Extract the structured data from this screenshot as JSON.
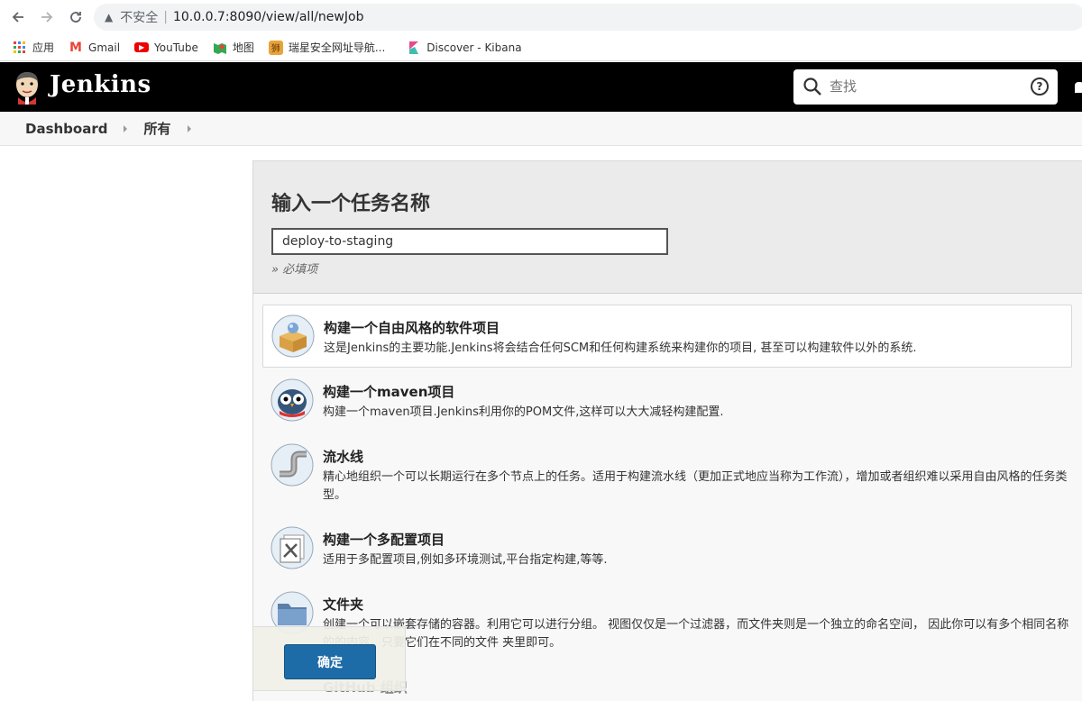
{
  "browser": {
    "insecure_label": "不安全",
    "separator": "|",
    "url": "10.0.0.7:8090/view/all/newJob",
    "bookmarks": [
      {
        "label": "应用",
        "icon": "apps-grid-icon"
      },
      {
        "label": "Gmail",
        "icon": "gmail-icon"
      },
      {
        "label": "YouTube",
        "icon": "youtube-icon"
      },
      {
        "label": "地图",
        "icon": "maps-icon"
      },
      {
        "label": "瑞星安全网址导航...",
        "icon": "rising-icon"
      },
      {
        "label": "Discover - Kibana",
        "icon": "kibana-icon"
      }
    ]
  },
  "header": {
    "brand": "Jenkins",
    "search_placeholder": "查找",
    "help_glyph": "?"
  },
  "breadcrumb": {
    "items": [
      "Dashboard",
      "所有"
    ]
  },
  "form": {
    "title": "输入一个任务名称",
    "job_name_value": "deploy-to-staging",
    "required_note": "» 必填项"
  },
  "job_types": [
    {
      "title": "构建一个自由风格的软件项目",
      "desc": "这是Jenkins的主要功能.Jenkins将会结合任何SCM和任何构建系统来构建你的项目, 甚至可以构建软件以外的系统.",
      "selected": true
    },
    {
      "title": "构建一个maven项目",
      "desc": "构建一个maven项目.Jenkins利用你的POM文件,这样可以大大减轻构建配置."
    },
    {
      "title": "流水线",
      "desc": "精心地组织一个可以长期运行在多个节点上的任务。适用于构建流水线（更加正式地应当称为工作流），增加或者组织难以采用自由风格的任务类型。"
    },
    {
      "title": "构建一个多配置项目",
      "desc": "适用于多配置项目,例如多环境测试,平台指定构建,等等."
    },
    {
      "title": "文件夹",
      "desc": "创建一个可以嵌套存储的容器。利用它可以进行分组。 视图仅仅是一个过滤器，而文件夹则是一个独立的命名空间， 因此你可以有多个相同名称的的内容，只要它们在不同的文件 夹里即可。"
    },
    {
      "title": "GitHub 组织",
      "desc": ""
    }
  ],
  "actions": {
    "ok_label": "确定"
  },
  "colors": {
    "header_bg": "#000000",
    "ok_button": "#1d6ca8",
    "name_section_bg": "#ebebeb"
  }
}
